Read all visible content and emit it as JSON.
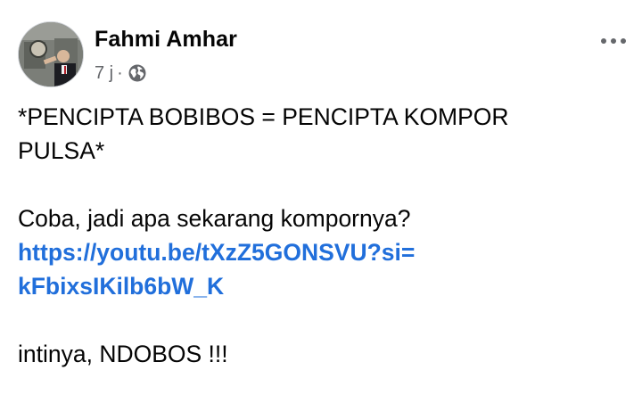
{
  "post": {
    "author": "Fahmi Amhar",
    "time": "7 j",
    "separator": "·",
    "visibility_icon": "globe-icon",
    "more_icon": "more-dots-icon",
    "text": {
      "line1": "*PENCIPTA BOBIBOS = PENCIPTA KOMPOR",
      "line2": "PULSA*",
      "line3": "Coba, jadi apa sekarang kompornya?",
      "link_line1": "https://youtu.be/tXzZ5GONSVU?si=",
      "link_line2": "kFbixsIKilb6bW_K",
      "line4": "intinya, NDOBOS !!!"
    }
  },
  "colors": {
    "link": "#216fdb",
    "meta": "#65676b",
    "text": "#050505"
  }
}
